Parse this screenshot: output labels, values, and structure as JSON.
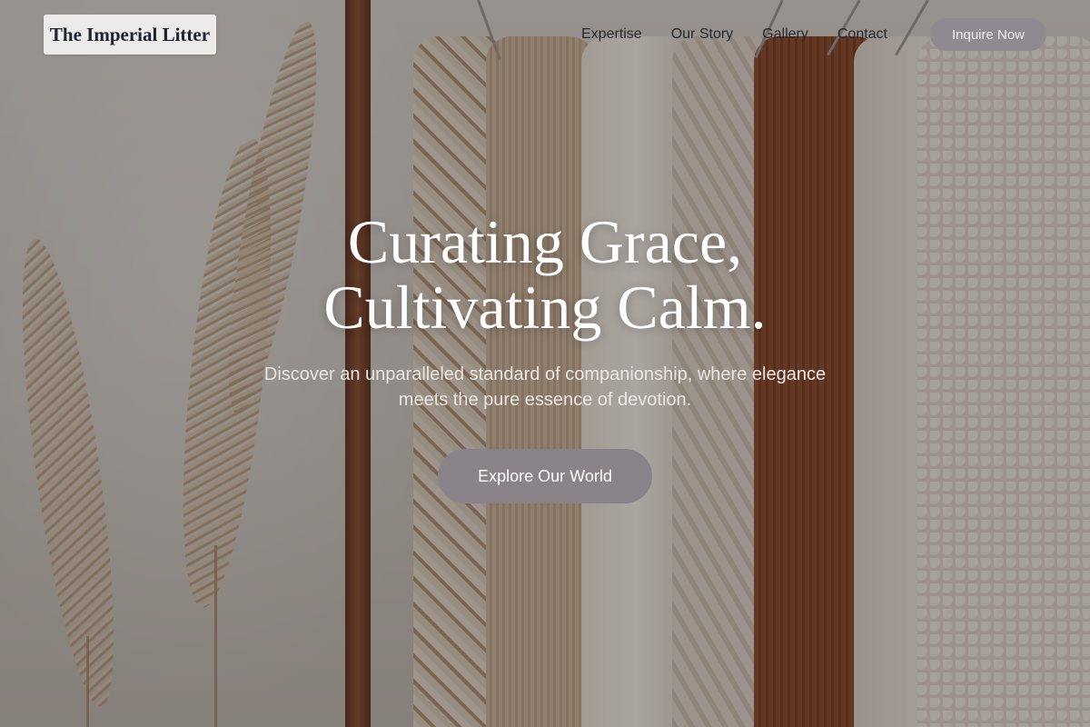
{
  "header": {
    "logo": "The Imperial Litter",
    "nav": [
      "Expertise",
      "Our Story",
      "Gallery",
      "Contact"
    ],
    "cta": "Inquire Now"
  },
  "hero": {
    "title_line1": "Curating Grace,",
    "title_line2": "Cultivating Calm.",
    "subtitle_line1": "Discover an unparalleled standard of companionship, where elegance",
    "subtitle_line2": "meets the pure essence of devotion.",
    "cta": "Explore Our World"
  },
  "colors": {
    "overlay": "#1e1816",
    "button": "#8a8389",
    "logo_bg": "#ecebea",
    "nav_text": "#262830"
  },
  "background": {
    "subject": "clothing-rack-with-knit-sweaters-and-pampas-grass"
  }
}
